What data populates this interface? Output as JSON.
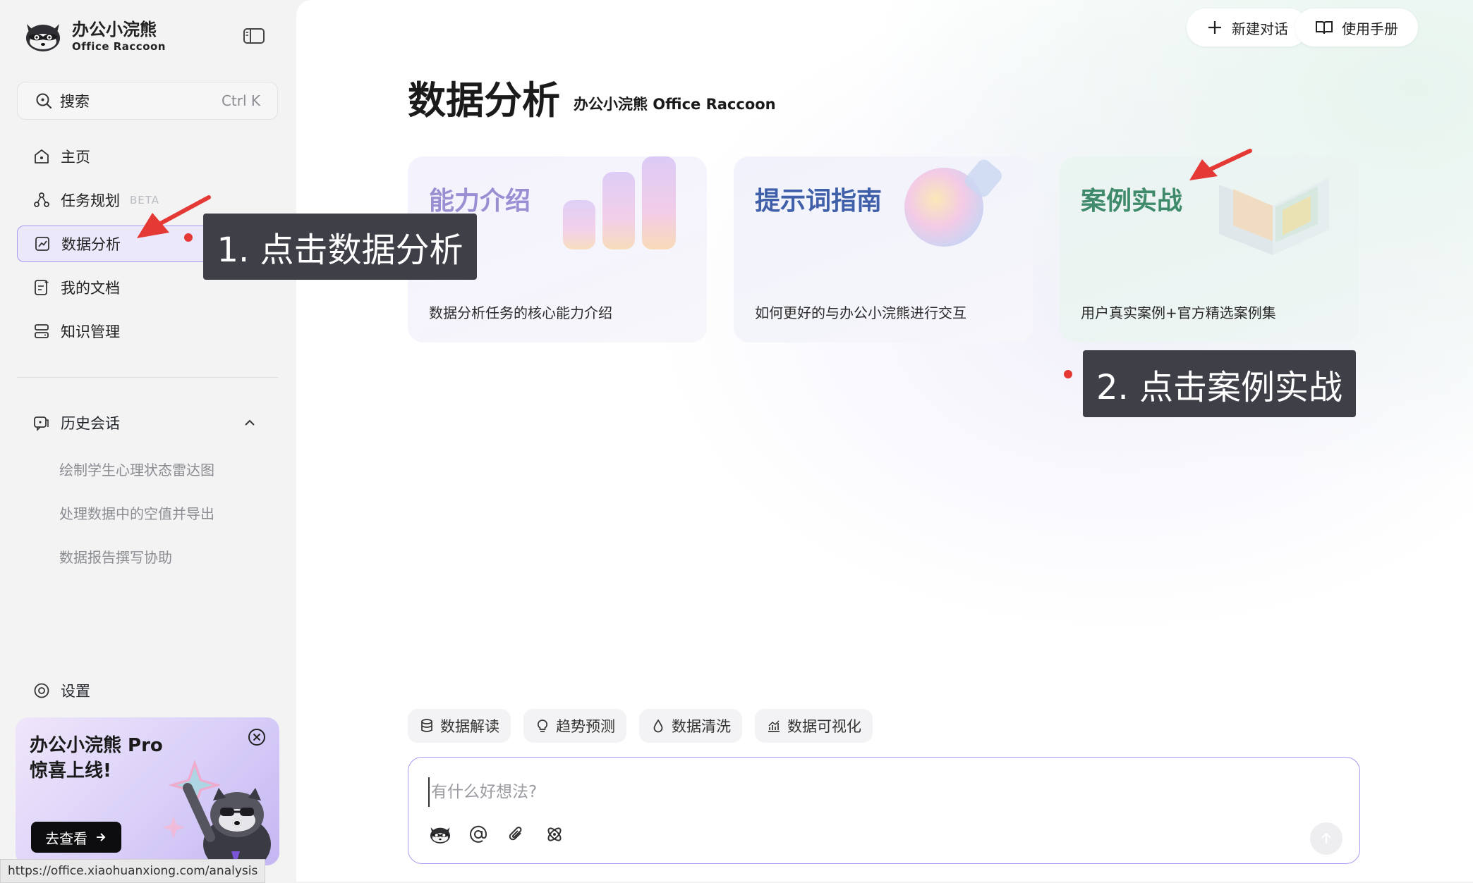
{
  "brand": {
    "title": "办公小浣熊",
    "subtitle": "Office Raccoon"
  },
  "search": {
    "label": "搜索",
    "shortcut": "Ctrl K"
  },
  "nav": {
    "items": [
      {
        "label": "主页",
        "icon": "home-icon"
      },
      {
        "label": "任务规划",
        "icon": "task-flow-icon",
        "badge": "BETA"
      },
      {
        "label": "数据分析",
        "icon": "data-analysis-icon",
        "active": true
      },
      {
        "label": "我的文档",
        "icon": "document-icon"
      },
      {
        "label": "知识管理",
        "icon": "knowledge-icon"
      }
    ]
  },
  "history": {
    "title": "历史会话",
    "items": [
      {
        "label": "绘制学生心理状态雷达图"
      },
      {
        "label": "处理数据中的空值并导出"
      },
      {
        "label": "数据报告撰写协助"
      }
    ]
  },
  "settings": {
    "label": "设置"
  },
  "promo": {
    "title_line1": "办公小浣熊 Pro",
    "title_line2": "惊喜上线!",
    "button": "去查看"
  },
  "status_url": "https://office.xiaohuanxiong.com/analysis",
  "header": {
    "new_chat": "新建对话",
    "manual": "使用手册"
  },
  "page": {
    "title": "数据分析",
    "subtitle": "办公小浣熊 Office Raccoon"
  },
  "cards": [
    {
      "title": "能力介绍",
      "desc": "数据分析任务的核心能力介绍",
      "title_color": "#9b8fd4"
    },
    {
      "title": "提示词指南",
      "desc": "如何更好的与办公小浣熊进行交互",
      "title_color": "#3f5fa8"
    },
    {
      "title": "案例实战",
      "desc": "用户真实案例+官方精选案例集",
      "title_color": "#3f8a6a"
    }
  ],
  "chips": [
    {
      "label": "数据解读",
      "icon": "database-icon"
    },
    {
      "label": "趋势预测",
      "icon": "lightbulb-icon"
    },
    {
      "label": "数据清洗",
      "icon": "droplet-icon"
    },
    {
      "label": "数据可视化",
      "icon": "chart-icon"
    }
  ],
  "composer": {
    "placeholder": "有什么好想法?"
  },
  "annotations": {
    "step1": "1. 点击数据分析",
    "step2": "2. 点击案例实战"
  },
  "colors": {
    "accent": "#a99bf0",
    "active_bg": "#ebe8fb",
    "callout_bg": "#3e3f47",
    "annotation_red": "#e53935"
  }
}
